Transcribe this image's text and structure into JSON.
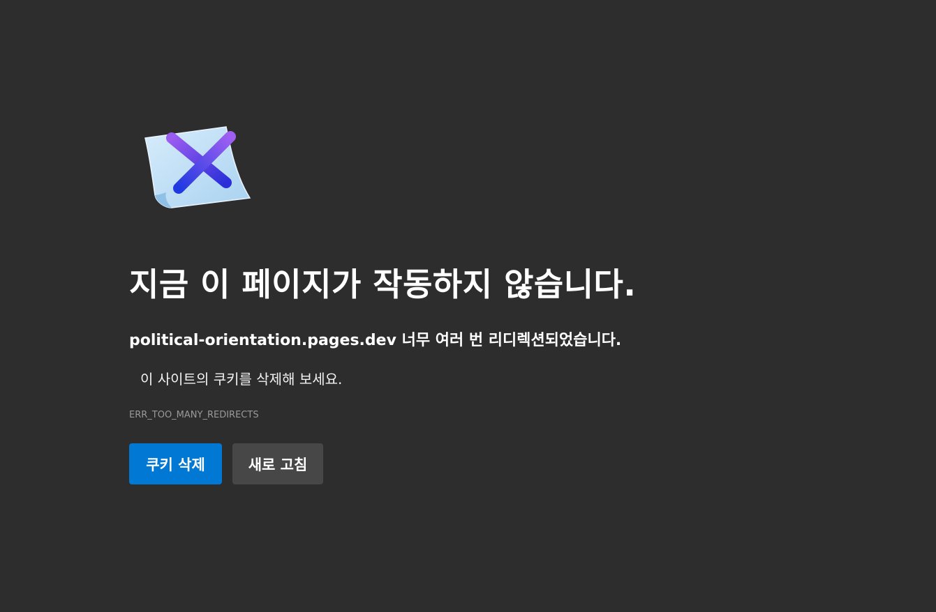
{
  "error": {
    "title": "지금 이 페이지가 작동하지 않습니다.",
    "host": "political-orientation.pages.dev",
    "message": " 너무 여러 번 리디렉션되었습니다.",
    "suggestion": "이 사이트의 쿠키를 삭제해 보세요.",
    "code": "ERR_TOO_MANY_REDIRECTS",
    "icon": "broken-page-x-icon"
  },
  "buttons": {
    "clear_cookies_label": "쿠키 삭제",
    "reload_label": "새로 고침"
  },
  "colors": {
    "background": "#2d2d2d",
    "primary_button": "#0078d4",
    "secondary_button": "#474747",
    "error_code_text": "#9a9a9a"
  }
}
